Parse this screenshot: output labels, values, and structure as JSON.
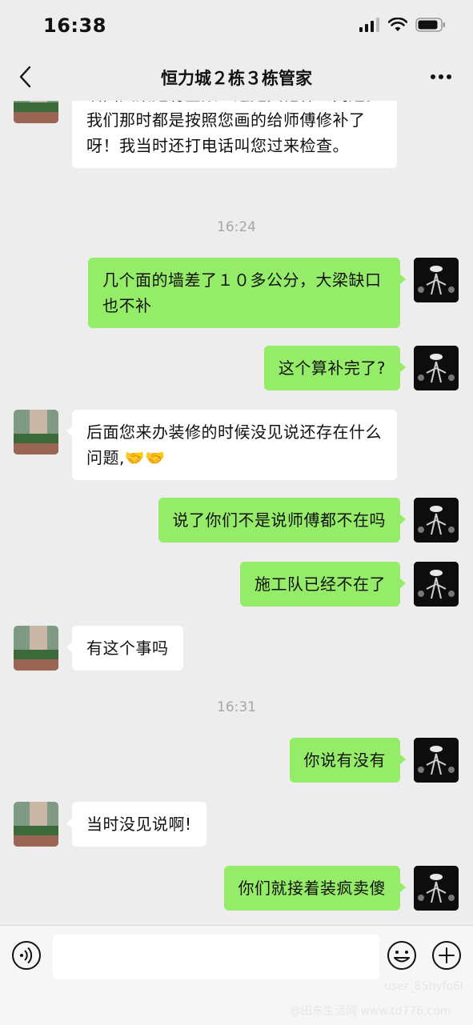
{
  "status_bar": {
    "time": "16:38"
  },
  "header": {
    "title": "恒力城２栋３栋管家"
  },
  "messages": [
    {
      "side": "left",
      "text": "墙面大桌是有空数？还是其他什么问题。我们那时都是按照您画的给师傅修补了呀！我当时还打电话叫您过来检查。"
    },
    {
      "type": "time",
      "text": "16:24"
    },
    {
      "side": "right",
      "text": "几个面的墙差了１０多公分，大梁缺口也不补"
    },
    {
      "side": "right",
      "text": "这个算补完了?"
    },
    {
      "side": "left",
      "text": "后面您来办装修的时候没见说还存在什么问题,🤝🤝"
    },
    {
      "side": "right",
      "text": "说了你们不是说师傅都不在吗"
    },
    {
      "side": "right",
      "text": "施工队已经不在了"
    },
    {
      "side": "left",
      "text": "有这个事吗"
    },
    {
      "type": "time",
      "text": "16:31"
    },
    {
      "side": "right",
      "text": "你说有没有"
    },
    {
      "side": "left",
      "text": "当时没见说啊!"
    },
    {
      "side": "right",
      "text": "你们就接着装疯卖傻"
    }
  ],
  "input": {
    "placeholder": ""
  },
  "watermark": {
    "user": "user_85hyfo6l",
    "site": "@田东生活网 www.td776.com"
  },
  "colors": {
    "background": "#ededed",
    "bubble_self": "#95ec69",
    "bubble_other": "#ffffff",
    "timestamp": "#a6a6a6"
  },
  "icons": {
    "back": "chevron-left-icon",
    "more": "more-horizontal-icon",
    "voice": "voice-icon",
    "emoji": "emoji-icon",
    "plus": "plus-icon"
  }
}
